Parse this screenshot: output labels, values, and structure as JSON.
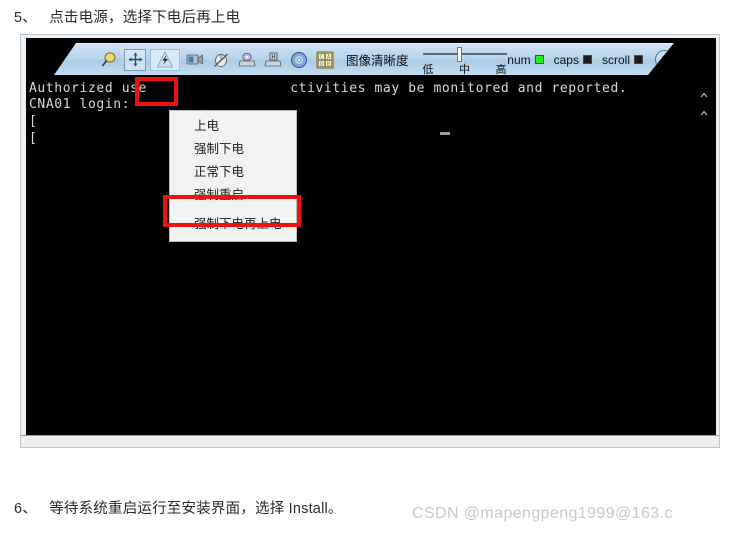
{
  "document": {
    "step5": {
      "number": "5、",
      "text": "点击电源，选择下电后再上电"
    },
    "step6": {
      "number": "6、",
      "text": "等待系统重启运行至安装界面，选择 Install。"
    },
    "watermark": "CSDN @mapengpeng1999@163.c"
  },
  "kvm": {
    "toolbar": {
      "icons": [
        {
          "name": "magnifier-icon",
          "title": "缩放"
        },
        {
          "name": "resize-icon",
          "title": "自适应"
        },
        {
          "name": "power-icon",
          "title": "电源"
        },
        {
          "name": "video-icon",
          "title": "视频"
        },
        {
          "name": "mouse-disabled-icon",
          "title": "鼠标"
        },
        {
          "name": "cd-drive-icon",
          "title": "光驱"
        },
        {
          "name": "floppy-drive-icon",
          "title": "软驱"
        },
        {
          "name": "disc-icon",
          "title": "镜像"
        },
        {
          "name": "keyboard-layout-icon",
          "title": "键盘布局"
        }
      ],
      "clarity_label": "图像清晰度",
      "slider": {
        "low": "低",
        "mid": "中",
        "high": "高",
        "value_percent": 42
      },
      "indicators": [
        {
          "label": "num",
          "state": "on",
          "color": "#22ee22"
        },
        {
          "label": "caps",
          "state": "off",
          "color": "#1a1a1a"
        },
        {
          "label": "scroll",
          "state": "off",
          "color": "#1a1a1a"
        }
      ],
      "help_label": "?"
    },
    "terminal": {
      "line1": "Authorized use                 ctivities may be monitored and reported.",
      "line2": "CNA01 login:",
      "line3": "[",
      "line4": "[",
      "caret1": "^",
      "caret2": "^"
    },
    "power_menu": {
      "items": [
        {
          "label": "上电",
          "highlighted": false
        },
        {
          "label": "强制下电",
          "highlighted": false
        },
        {
          "label": "正常下电",
          "highlighted": false
        },
        {
          "label": "强制重启",
          "highlighted": false
        },
        {
          "label": "强制下电再上电",
          "highlighted": true
        }
      ]
    },
    "annotations": {
      "power_icon_box": "highlight-power-icon",
      "menu_item_box": "highlight-force-power-cycle"
    }
  },
  "colors": {
    "annotation_red": "#ee1111",
    "toolbar_blue": "#b6d4ea",
    "terminal_bg": "#000000",
    "led_on": "#22ee22"
  }
}
